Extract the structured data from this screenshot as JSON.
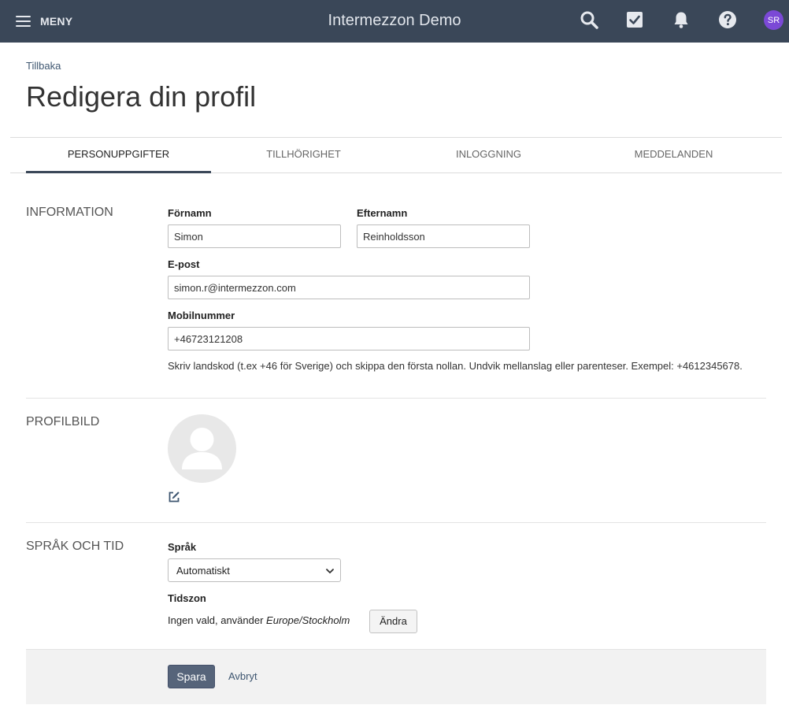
{
  "topbar": {
    "menu_label": "MENY",
    "app_title": "Intermezzon Demo",
    "avatar_initials": "SR",
    "avatar_color": "#7b49d6",
    "bar_color": "#3a4758",
    "icons": [
      "search-icon",
      "tasks-check-icon",
      "bell-icon",
      "help-icon"
    ]
  },
  "header": {
    "back_label": "Tillbaka",
    "title": "Redigera din profil"
  },
  "tabs": [
    {
      "label": "PERSONUPPGIFTER",
      "active": true
    },
    {
      "label": "TILLHÖRIGHET",
      "active": false
    },
    {
      "label": "INLOGGNING",
      "active": false
    },
    {
      "label": "MEDDELANDEN",
      "active": false
    }
  ],
  "information": {
    "section_title": "INFORMATION",
    "first_name_label": "Förnamn",
    "first_name_value": "Simon",
    "last_name_label": "Efternamn",
    "last_name_value": "Reinholdsson",
    "email_label": "E-post",
    "email_value": "simon.r@intermezzon.com",
    "mobile_label": "Mobilnummer",
    "mobile_value": "+46723121208",
    "mobile_help": "Skriv landskod (t.ex +46 för Sverige) och skippa den första nollan. Undvik mellanslag eller parenteser. Exempel: +4612345678."
  },
  "profile_picture": {
    "section_title": "PROFILBILD"
  },
  "language_time": {
    "section_title": "SPRÅK OCH TID",
    "language_label": "Språk",
    "language_value": "Automatiskt",
    "timezone_label": "Tidszon",
    "timezone_text_prefix": "Ingen vald, använder ",
    "timezone_text_value": "Europe/Stockholm",
    "change_label": "Ändra"
  },
  "footer": {
    "save_label": "Spara",
    "cancel_label": "Avbryt"
  }
}
